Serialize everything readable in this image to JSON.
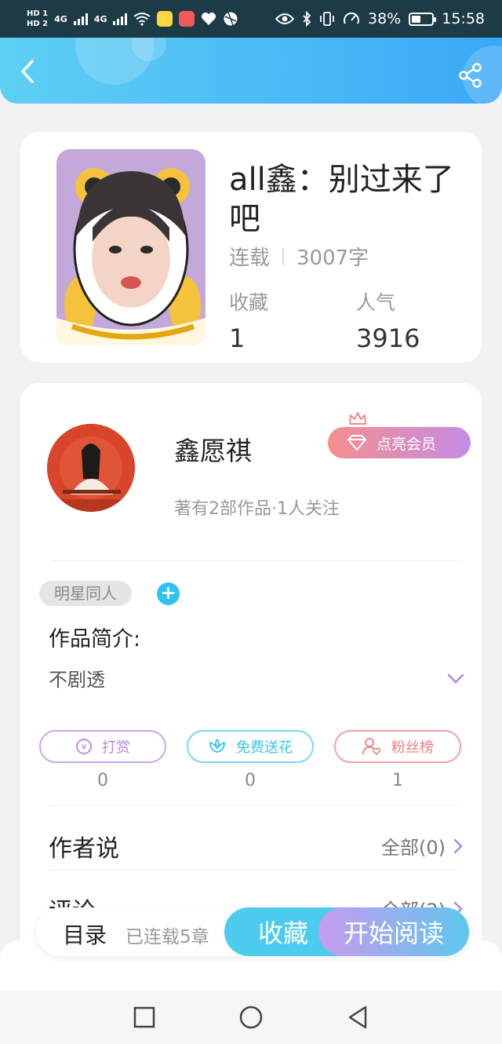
{
  "status_bar": {
    "hd1": "HD 1",
    "hd2": "HD 2",
    "net1": "4G",
    "net2": "4G",
    "battery": "38%",
    "time": "15:58"
  },
  "book": {
    "title": "all鑫：别过来了吧",
    "status": "连载",
    "word_count": "3007字",
    "collect_label": "收藏",
    "collect_value": "1",
    "popularity_label": "人气",
    "popularity_value": "3916"
  },
  "author": {
    "name": "鑫愿祺",
    "vip_label": "点亮会员",
    "stats": "著有2部作品·1人关注"
  },
  "tag": "明星同人",
  "intro": {
    "title": "作品简介:",
    "text": "不剧透"
  },
  "actions": [
    {
      "label": "打赏",
      "count": "0"
    },
    {
      "label": "免费送花",
      "count": "0"
    },
    {
      "label": "粉丝榜",
      "count": "1"
    }
  ],
  "author_says": {
    "title": "作者说",
    "more": "全部(0)"
  },
  "comments": {
    "title": "评论",
    "more": "全部(2)"
  },
  "bottom_bar": {
    "toc": "目录",
    "chapters": "已连载5章",
    "collect": "收藏",
    "read": "开始阅读"
  },
  "colors": {
    "header_start": "#5ed0f4",
    "header_end": "#3aa8f7",
    "accent_blue": "#4dcbee",
    "accent_purple": "#c79bef",
    "tip_color": "#b586e0",
    "flower_color": "#3cc4ea",
    "fans_color": "#ee8080"
  }
}
